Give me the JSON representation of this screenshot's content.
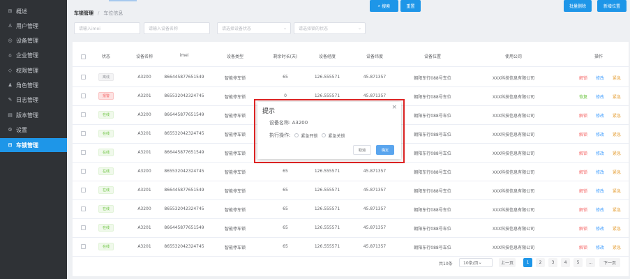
{
  "sidebar": {
    "items": [
      {
        "label": "概述",
        "icon": "grid-icon"
      },
      {
        "label": "用户管理",
        "icon": "user-icon"
      },
      {
        "label": "设备管理",
        "icon": "location-icon"
      },
      {
        "label": "企业管理",
        "icon": "building-icon"
      },
      {
        "label": "权限管理",
        "icon": "shield-icon"
      },
      {
        "label": "角色管理",
        "icon": "people-icon"
      },
      {
        "label": "日志管理",
        "icon": "log-icon"
      },
      {
        "label": "版本管理",
        "icon": "version-icon"
      },
      {
        "label": "设置",
        "icon": "gear-icon"
      },
      {
        "label": "车锁管理",
        "icon": "lock-icon",
        "active": true
      }
    ]
  },
  "breadcrumb": {
    "parent": "车锁管理",
    "separator": "/",
    "current": "车位信息"
  },
  "filters": {
    "name_placeholder": "请输入imei",
    "device_placeholder": "请输入设备名称",
    "status_placeholder": "请选择设备状态",
    "type_placeholder": "请选择锁的状态",
    "search_label": "搜索",
    "reset_label": "重置",
    "batch_delete_label": "批量删除",
    "add_label": "新增位置"
  },
  "table": {
    "headers": [
      "状态",
      "设备名称",
      "imei",
      "设备类型",
      "剩余时长(天)",
      "设备经度",
      "设备纬度",
      "设备位置",
      "使用公司",
      "操作"
    ],
    "rows": [
      {
        "status": "离线",
        "status_type": "offline",
        "name": "A3200",
        "imei": "866445877651549",
        "type": "智能停车锁",
        "days": "65",
        "lng": "126.555571",
        "lat": "45.871357",
        "location": "朝阳东行088号车位",
        "company": "XXX科技信息有限公司",
        "act1": "解锁",
        "act1_type": "red"
      },
      {
        "status": "报警",
        "status_type": "alarm",
        "name": "A3201",
        "imei": "865532042324745",
        "type": "智能停车锁",
        "days": "0",
        "lng": "126.555571",
        "lat": "45.871357",
        "location": "朝阳东行088号车位",
        "company": "XXX科技信息有限公司",
        "act1": "恢复",
        "act1_type": "green"
      },
      {
        "status": "在线",
        "status_type": "online",
        "name": "A3200",
        "imei": "866445877651549",
        "type": "智能停车锁",
        "days": "",
        "lng": "",
        "lat": "",
        "location": "朝阳东行088号车位",
        "company": "XXX科技信息有限公司",
        "act1": "解锁",
        "act1_type": "red"
      },
      {
        "status": "在线",
        "status_type": "online",
        "name": "A3201",
        "imei": "865532042324745",
        "type": "智能停车锁",
        "days": "",
        "lng": "",
        "lat": "",
        "location": "朝阳东行088号车位",
        "company": "XXX科技信息有限公司",
        "act1": "解锁",
        "act1_type": "red"
      },
      {
        "status": "在线",
        "status_type": "online",
        "name": "A3201",
        "imei": "866445877651549",
        "type": "智能停车锁",
        "days": "",
        "lng": "",
        "lat": "",
        "location": "朝阳东行088号车位",
        "company": "XXX科技信息有限公司",
        "act1": "解锁",
        "act1_type": "red"
      },
      {
        "status": "在线",
        "status_type": "online",
        "name": "A3200",
        "imei": "865532042324745",
        "type": "智能停车锁",
        "days": "65",
        "lng": "126.555571",
        "lat": "45.871357",
        "location": "朝阳东行088号车位",
        "company": "XXX科技信息有限公司",
        "act1": "解锁",
        "act1_type": "red"
      },
      {
        "status": "在线",
        "status_type": "online",
        "name": "A3201",
        "imei": "866445877651549",
        "type": "智能停车锁",
        "days": "65",
        "lng": "126.555571",
        "lat": "45.871357",
        "location": "朝阳东行088号车位",
        "company": "XXX科技信息有限公司",
        "act1": "解锁",
        "act1_type": "red"
      },
      {
        "status": "在线",
        "status_type": "online",
        "name": "A3200",
        "imei": "865532042324745",
        "type": "智能停车锁",
        "days": "65",
        "lng": "126.555571",
        "lat": "45.871357",
        "location": "朝阳东行088号车位",
        "company": "XXX科技信息有限公司",
        "act1": "解锁",
        "act1_type": "red"
      },
      {
        "status": "在线",
        "status_type": "online",
        "name": "A3201",
        "imei": "866445877651549",
        "type": "智能停车锁",
        "days": "65",
        "lng": "126.555571",
        "lat": "45.871357",
        "location": "朝阳东行088号车位",
        "company": "XXX科技信息有限公司",
        "act1": "解锁",
        "act1_type": "red"
      },
      {
        "status": "在线",
        "status_type": "online",
        "name": "A3201",
        "imei": "865532042324745",
        "type": "智能停车锁",
        "days": "65",
        "lng": "126.555571",
        "lat": "45.871357",
        "location": "朝阳东行088号车位",
        "company": "XXX科技信息有限公司",
        "act1": "解锁",
        "act1_type": "red"
      }
    ],
    "act_edit": "修改",
    "act_urgent": "紧急"
  },
  "pagination": {
    "total": "共10条",
    "page_size": "10条/页",
    "prev": "上一页",
    "pages": [
      "1",
      "2",
      "3",
      "4",
      "5",
      "..."
    ],
    "current": "1",
    "next": "下一页"
  },
  "dialog": {
    "title": "提示",
    "device_line": "设备名称: A3200",
    "action_label": "执行操作:",
    "option_start": "紧急开锁",
    "option_close": "紧急关锁",
    "cancel_label": "取消",
    "ok_label": "确定"
  },
  "colors": {
    "accent": "#1e96e8",
    "sidebar_bg": "#2f3236",
    "dialog_highlight": "#e02424"
  }
}
